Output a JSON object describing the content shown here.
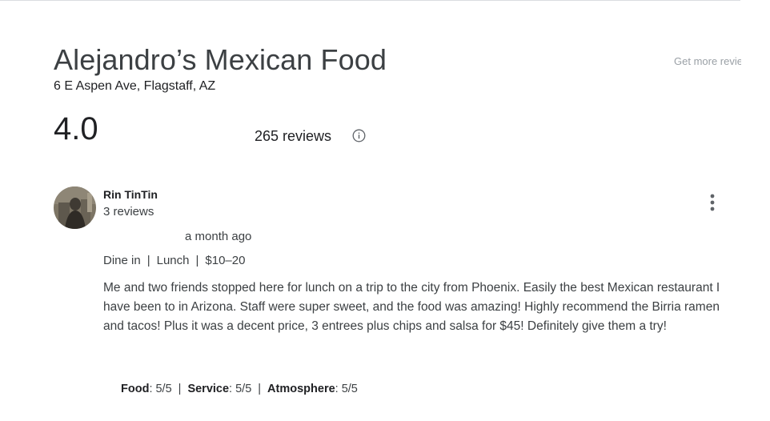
{
  "place": {
    "name": "Alejandro’s Mexican Food",
    "address": "6 E Aspen Ave, Flagstaff, AZ",
    "rating": "4.0",
    "review_count": "265 reviews",
    "more_reviews_link": "Get more reviews"
  },
  "review": {
    "author": "Rin TinTin",
    "author_reviews": "3 reviews",
    "date": "a month ago",
    "meta": {
      "service_type": "Dine in",
      "meal": "Lunch",
      "price": "$10–20",
      "separator": "|"
    },
    "text": "Me and two friends stopped here for lunch on a trip to the city from Phoenix. Easily the best Mexican restaurant I have been to in Arizona. Staff were super sweet, and the food was amazing! Highly recommend the Birria ramen and tacos! Plus it was a decent price, 3 entrees plus chips and salsa for $45! Definitely give them a try!",
    "ratings": {
      "food_label": "Food",
      "food_value": ": 5/5",
      "service_label": "Service",
      "service_value": ": 5/5",
      "atmosphere_label": "Atmosphere",
      "atmosphere_value": ": 5/5",
      "separator": "|"
    }
  },
  "icons": {
    "info": "info-icon",
    "more": "more-vert-icon",
    "avatar": "avatar"
  },
  "colors": {
    "text": "#202124",
    "secondary": "#3c4043",
    "muted": "#9aa0a6"
  }
}
